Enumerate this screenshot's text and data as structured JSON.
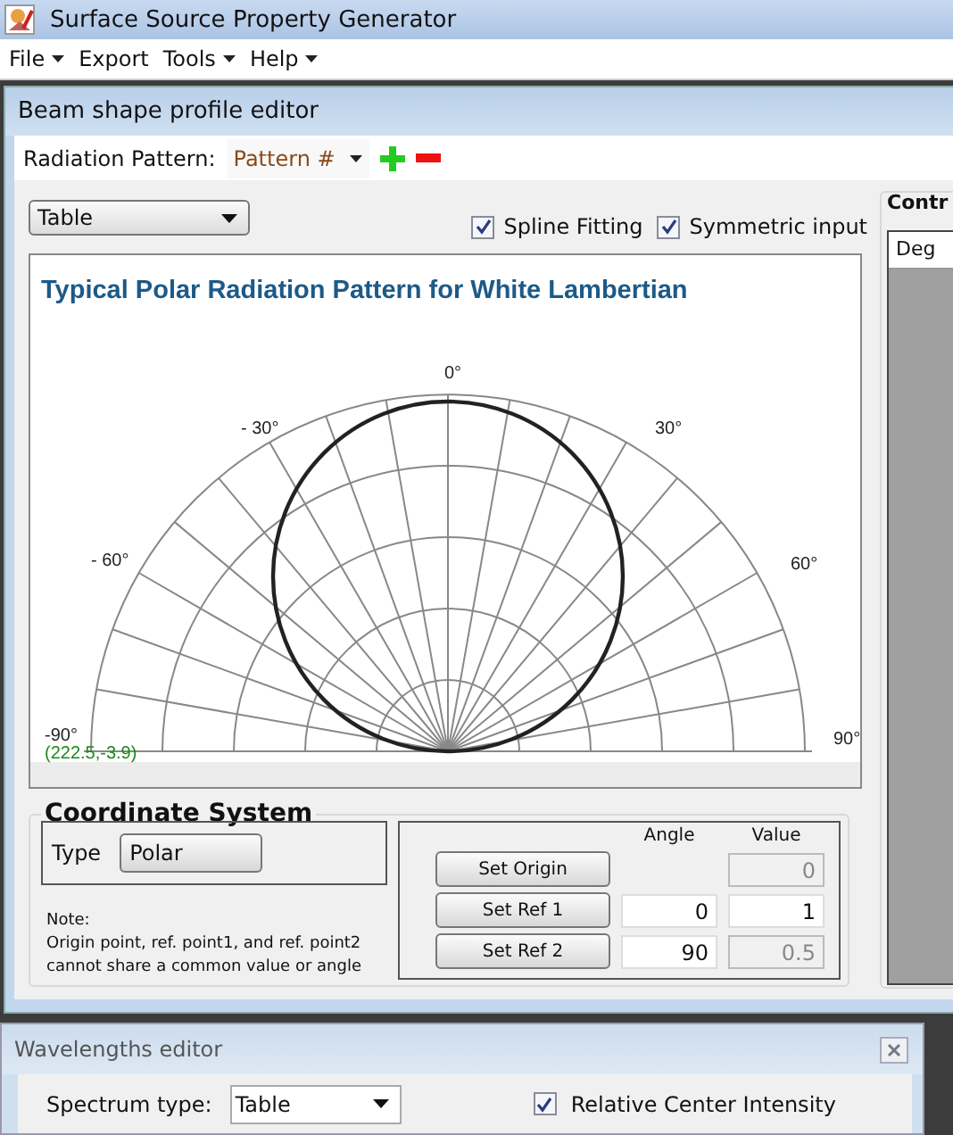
{
  "window": {
    "title": "Surface Source Property Generator"
  },
  "menu": [
    {
      "label": "File",
      "dropdown": true
    },
    {
      "label": "Export",
      "dropdown": false
    },
    {
      "label": "Tools",
      "dropdown": true
    },
    {
      "label": "Help",
      "dropdown": true
    }
  ],
  "beam_editor": {
    "title": "Beam shape profile editor",
    "radiation_pattern": {
      "label": "Radiation Pattern:",
      "value": "Pattern #"
    },
    "mode_select": {
      "value": "Table"
    },
    "options": [
      {
        "label": "Spline Fitting",
        "checked": true
      },
      {
        "label": "Symmetric input",
        "checked": true
      }
    ],
    "image": {
      "title": "Typical Polar Radiation Pattern for White Lambertian",
      "angle_labels": [
        "0°",
        "- 30°",
        "30°",
        "- 60°",
        "60°",
        "-90°",
        "90°"
      ],
      "cursor_readout": "(222.5,-3.9)"
    },
    "coordinate_system": {
      "title": "Coordinate System",
      "type_label": "Type",
      "type_value": "Polar",
      "note": [
        "Note:",
        "Origin point, ref. point1, and ref. point2",
        "cannot share a common value or angle"
      ],
      "columns": [
        "Angle",
        "Value"
      ],
      "rows": [
        {
          "button": "Set Origin",
          "value": "0",
          "value_disabled": true
        },
        {
          "button": "Set Ref 1",
          "angle": "0",
          "value": "1",
          "value_disabled": false
        },
        {
          "button": "Set Ref 2",
          "angle": "90",
          "value": "0.5",
          "value_disabled": true
        }
      ]
    }
  },
  "control_panel": {
    "title": "Contr",
    "column": "Deg"
  },
  "wavelengths_editor": {
    "title": "Wavelengths editor",
    "spectrum_label": "Spectrum type:",
    "spectrum_value": "Table",
    "relative": {
      "label": "Relative Center Intensity",
      "checked": true
    }
  }
}
